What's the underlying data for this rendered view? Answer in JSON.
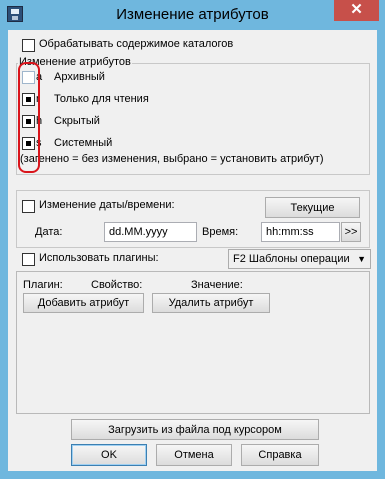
{
  "window": {
    "title": "Изменение атрибутов",
    "close_glyph": "✕"
  },
  "process_dirs": {
    "label": "Обрабатывать содержимое каталогов",
    "checked": false
  },
  "attributes_group": {
    "legend": "Изменение атрибутов",
    "items": [
      {
        "key": "a",
        "label": "Архивный",
        "state": "grayed"
      },
      {
        "key": "r",
        "label": "Только для чтения",
        "state": "indeterminate"
      },
      {
        "key": "h",
        "label": "Скрытый",
        "state": "indeterminate"
      },
      {
        "key": "s",
        "label": "Системный",
        "state": "indeterminate"
      }
    ],
    "hint": "(загенено = без изменения, выбрано = установить атрибут)"
  },
  "datetime": {
    "label": "Изменение даты/времени:",
    "checked": false,
    "current_button": "Текущие",
    "date_label": "Дата:",
    "date_value": "dd.MM.yyyy",
    "time_label": "Время:",
    "time_value": "hh:mm:ss",
    "more_button": ">>"
  },
  "plugins": {
    "label": "Использовать плагины:",
    "checked": false,
    "combo_value": "F2 Шаблоны операции",
    "headers": {
      "plugin": "Плагин:",
      "property": "Свойство:",
      "value": "Значение:"
    },
    "add_button": "Добавить атрибут",
    "remove_button": "Удалить атрибут"
  },
  "footer": {
    "load_button": "Загрузить из файла под курсором",
    "ok_button": "OK",
    "cancel_button": "Отмена",
    "help_button": "Справка"
  },
  "colors": {
    "title_bar": "#6fb7de",
    "close_button": "#c7504a",
    "annotation": "#d9141b"
  }
}
